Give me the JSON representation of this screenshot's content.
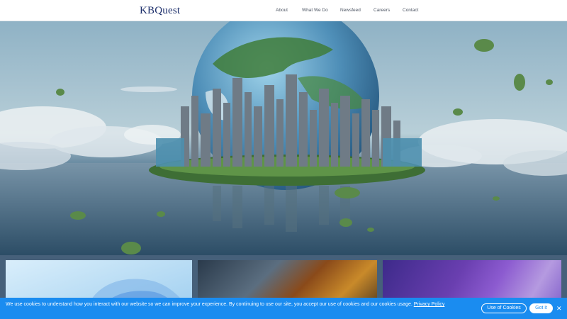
{
  "header": {
    "logo": "KBQuest",
    "nav": [
      {
        "label": "About"
      },
      {
        "label": "What We Do"
      },
      {
        "label": "Newsfeed"
      },
      {
        "label": "Careers"
      },
      {
        "label": "Contact"
      }
    ]
  },
  "cookie_bar": {
    "message": "We use cookies to understand how you interact with our website so we can improve your experience. By continuing to use our site, you accept our use of cookies and our cookies usage.",
    "policy_link": "Privacy Policy",
    "use_of_cookies_label": "Use of Cookies",
    "got_it_label": "Got it",
    "close_icon": "close-icon"
  },
  "colors": {
    "brand": "#1d2f6b",
    "cookie_bar": "#1a8cf0"
  }
}
